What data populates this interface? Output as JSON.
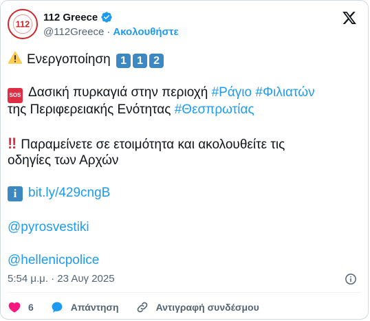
{
  "author": {
    "display_name": "112 Greece",
    "handle": "@112Greece",
    "separator": "·",
    "follow_label": "Ακολουθήστε",
    "avatar_text": "112"
  },
  "tweet": {
    "line1_text": "Ενεργοποίηση",
    "keycaps": [
      "1",
      "1",
      "2"
    ],
    "sos_badge": "SOS",
    "line2_text": "Δασική πυρκαγιά στην περιοχή",
    "hashtag1": "#Ράγιο",
    "hashtag2": "#Φιλιατών",
    "line3_text": "της Περιφερειακής Ενότητας",
    "hashtag3": "#Θεσπρωτίας",
    "bang": "‼",
    "line4_text": "Παραμείνετε σε ετοιμότητα και ακολουθείτε τις",
    "line5_text": "οδηγίες των Αρχών",
    "info_badge": "i",
    "link": "bit.ly/429cngB",
    "mention1": "@pyrosvestiki",
    "mention2": "@hellenicpolice"
  },
  "meta": {
    "timestamp": "5:54 μ.μ. · 23 Αυγ 2025"
  },
  "actions": {
    "like_count": "6",
    "reply_label": "Απάντηση",
    "copy_link_label": "Αντιγραφή συνδέσμου"
  },
  "colors": {
    "link": "#1d9bf0",
    "like": "#f91880",
    "brand_red": "#d0252a",
    "muted": "#536471"
  }
}
